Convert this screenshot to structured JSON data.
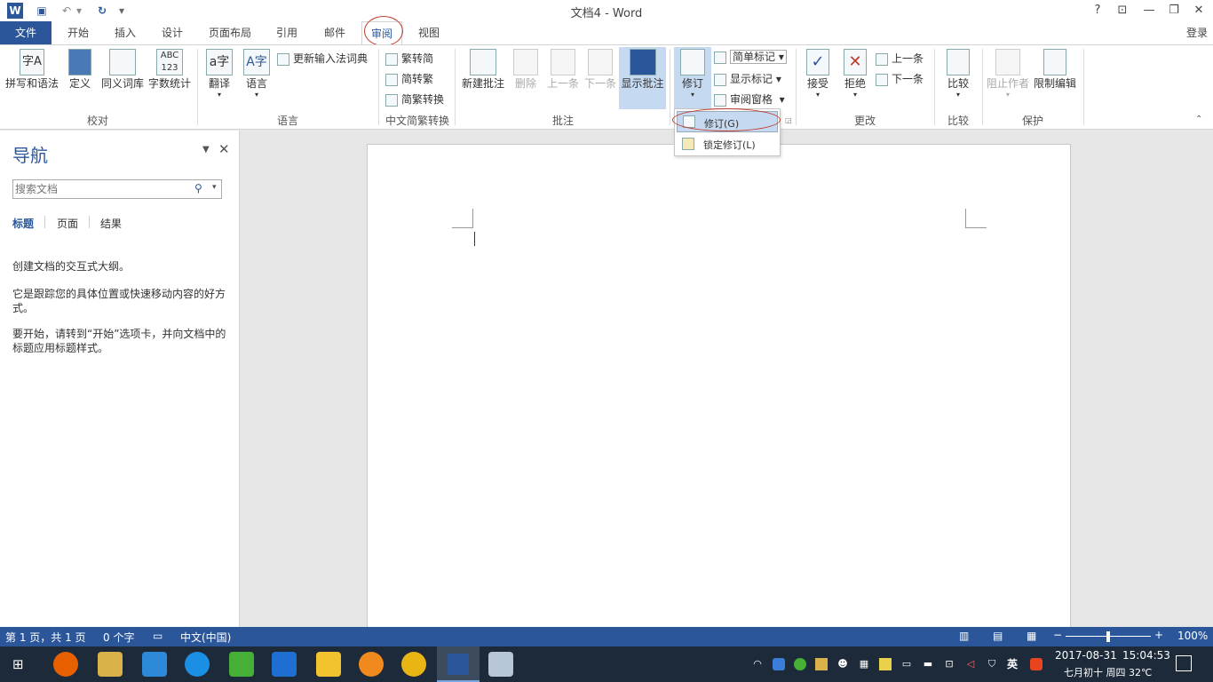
{
  "window": {
    "title": "文档4 - Word",
    "help": "?",
    "ribbon_display": "⊡",
    "minimize": "—",
    "restore": "❐",
    "close": "✕",
    "signin": "登录"
  },
  "qat": {
    "app_icon": "W",
    "save": "▣",
    "undo": "↶",
    "undo_arrow": "▾",
    "redo": "↻",
    "customize": "▾"
  },
  "tabs": [
    "文件",
    "开始",
    "插入",
    "设计",
    "页面布局",
    "引用",
    "邮件",
    "审阅",
    "视图"
  ],
  "ribbon": {
    "proofing": {
      "group": "校对",
      "spelling": "拼写和语法",
      "define": "定义",
      "thesaurus": "同义词库",
      "wordcount": "字数统计"
    },
    "language": {
      "group": "语言",
      "translate": "翻译",
      "language": "语言",
      "update_ime": "更新输入法词典"
    },
    "chinese": {
      "group": "中文简繁转换",
      "to_simplified": "繁转简",
      "to_traditional": "简转繁",
      "convert": "简繁转换"
    },
    "comments": {
      "group": "批注",
      "new": "新建批注",
      "delete": "删除",
      "prev": "上一条",
      "next": "下一条",
      "show": "显示批注"
    },
    "tracking": {
      "track": "修订",
      "markup": "简单标记",
      "show_markup": "显示标记",
      "pane": "审阅窗格"
    },
    "changes": {
      "group": "更改",
      "accept": "接受",
      "reject": "拒绝",
      "prev": "上一条",
      "next": "下一条"
    },
    "compare": {
      "group": "比较",
      "compare": "比较"
    },
    "protect": {
      "group": "保护",
      "block": "阻止作者",
      "restrict": "限制编辑"
    }
  },
  "dropdown": {
    "items": [
      "修订(G)",
      "锁定修订(L)"
    ]
  },
  "nav": {
    "title": "导航",
    "search_placeholder": "搜索文档",
    "tabs": [
      "标题",
      "页面",
      "结果"
    ],
    "p1": "创建文档的交互式大纲。",
    "p2": "它是跟踪您的具体位置或快速移动内容的好方式。",
    "p3": "要开始，请转到“开始”选项卡，并向文档中的标题应用标题样式。"
  },
  "status": {
    "page": "第 1 页，共 1 页",
    "words": "0 个字",
    "language": "中文(中国)",
    "zoom": "100%",
    "zoom_fraction": 0.5
  },
  "taskbar": {
    "ime": "英",
    "date": "2017-08-31",
    "time": "15:04:53",
    "lunar": "七月初十 周四 32℃"
  },
  "colors": {
    "accent": "#2b579a",
    "highlight": "#c5d9f1",
    "annotation": "#c0392b"
  }
}
